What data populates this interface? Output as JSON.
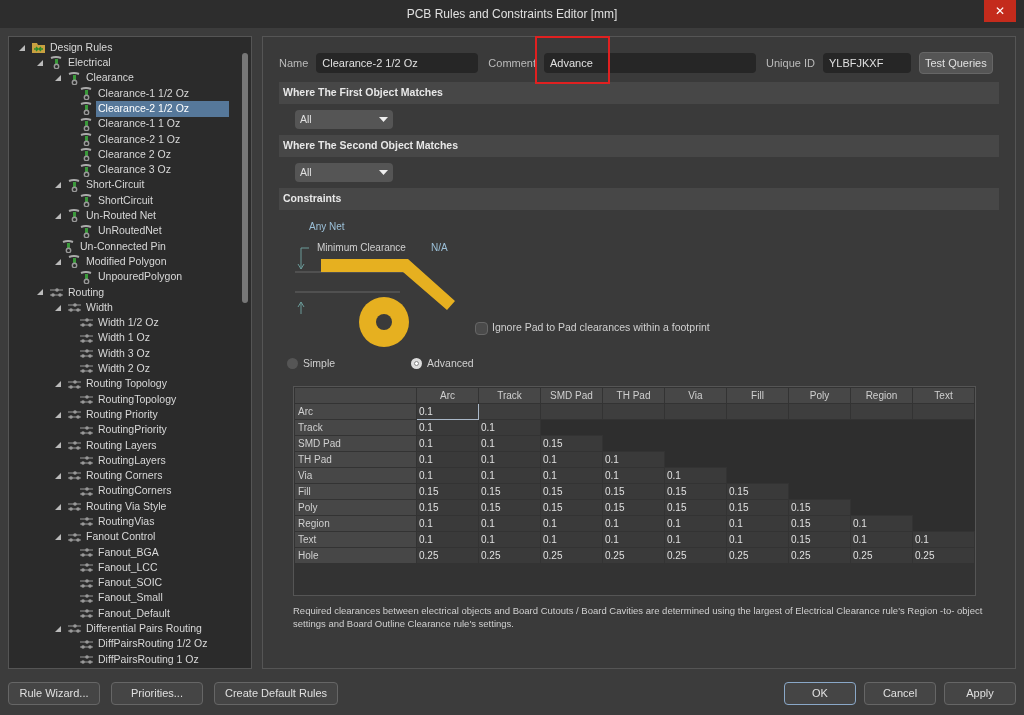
{
  "window": {
    "title": "PCB Rules and Constraints Editor [mm]",
    "close": "✕"
  },
  "tree": [
    {
      "label": "Design Rules",
      "kind": "root",
      "expanded": true,
      "selected": false,
      "children": [
        {
          "label": "Electrical",
          "kind": "electrical",
          "expanded": true,
          "selected": false,
          "children": [
            {
              "label": "Clearance",
              "kind": "electrical",
              "expanded": true,
              "selected": false,
              "children": [
                {
                  "label": "Clearance-1 1/2 Oz",
                  "kind": "electrical",
                  "selected": false
                },
                {
                  "label": "Clearance-2 1/2 Oz",
                  "kind": "electrical",
                  "selected": true
                },
                {
                  "label": "Clearance-1 1 Oz",
                  "kind": "electrical",
                  "selected": false
                },
                {
                  "label": "Clearance-2 1 Oz",
                  "kind": "electrical",
                  "selected": false
                },
                {
                  "label": "Clearance 2 Oz",
                  "kind": "electrical",
                  "selected": false
                },
                {
                  "label": "Clearance 3 Oz",
                  "kind": "electrical",
                  "selected": false
                }
              ]
            },
            {
              "label": "Short-Circuit",
              "kind": "electrical",
              "expanded": true,
              "selected": false,
              "children": [
                {
                  "label": "ShortCircuit",
                  "kind": "electrical",
                  "selected": false
                }
              ]
            },
            {
              "label": "Un-Routed Net",
              "kind": "electrical",
              "expanded": true,
              "selected": false,
              "children": [
                {
                  "label": "UnRoutedNet",
                  "kind": "electrical",
                  "selected": false
                }
              ]
            },
            {
              "label": "Un-Connected Pin",
              "kind": "electrical",
              "selected": false
            },
            {
              "label": "Modified Polygon",
              "kind": "electrical",
              "expanded": true,
              "selected": false,
              "children": [
                {
                  "label": "UnpouredPolygon",
                  "kind": "electrical",
                  "selected": false
                }
              ]
            }
          ]
        },
        {
          "label": "Routing",
          "kind": "routing",
          "expanded": true,
          "selected": false,
          "children": [
            {
              "label": "Width",
              "kind": "routing",
              "expanded": true,
              "selected": false,
              "children": [
                {
                  "label": "Width 1/2 Oz",
                  "kind": "routing",
                  "selected": false
                },
                {
                  "label": "Width 1 Oz",
                  "kind": "routing",
                  "selected": false
                },
                {
                  "label": "Width 3 Oz",
                  "kind": "routing",
                  "selected": false
                },
                {
                  "label": "Width 2 Oz",
                  "kind": "routing",
                  "selected": false
                }
              ]
            },
            {
              "label": "Routing Topology",
              "kind": "routing",
              "expanded": true,
              "selected": false,
              "children": [
                {
                  "label": "RoutingTopology",
                  "kind": "routing",
                  "selected": false
                }
              ]
            },
            {
              "label": "Routing Priority",
              "kind": "routing",
              "expanded": true,
              "selected": false,
              "children": [
                {
                  "label": "RoutingPriority",
                  "kind": "routing",
                  "selected": false
                }
              ]
            },
            {
              "label": "Routing Layers",
              "kind": "routing",
              "expanded": true,
              "selected": false,
              "children": [
                {
                  "label": "RoutingLayers",
                  "kind": "routing",
                  "selected": false
                }
              ]
            },
            {
              "label": "Routing Corners",
              "kind": "routing",
              "expanded": true,
              "selected": false,
              "children": [
                {
                  "label": "RoutingCorners",
                  "kind": "routing",
                  "selected": false
                }
              ]
            },
            {
              "label": "Routing Via Style",
              "kind": "routing",
              "expanded": true,
              "selected": false,
              "children": [
                {
                  "label": "RoutingVias",
                  "kind": "routing",
                  "selected": false
                }
              ]
            },
            {
              "label": "Fanout Control",
              "kind": "routing",
              "expanded": true,
              "selected": false,
              "children": [
                {
                  "label": "Fanout_BGA",
                  "kind": "routing",
                  "selected": false
                },
                {
                  "label": "Fanout_LCC",
                  "kind": "routing",
                  "selected": false
                },
                {
                  "label": "Fanout_SOIC",
                  "kind": "routing",
                  "selected": false
                },
                {
                  "label": "Fanout_Small",
                  "kind": "routing",
                  "selected": false
                },
                {
                  "label": "Fanout_Default",
                  "kind": "routing",
                  "selected": false
                }
              ]
            },
            {
              "label": "Differential Pairs Routing",
              "kind": "routing",
              "expanded": true,
              "selected": false,
              "children": [
                {
                  "label": "DiffPairsRouting 1/2 Oz",
                  "kind": "routing",
                  "selected": false
                },
                {
                  "label": "DiffPairsRouting 1 Oz",
                  "kind": "routing",
                  "selected": false
                }
              ]
            }
          ]
        }
      ]
    }
  ],
  "header": {
    "name_label": "Name",
    "name": "Clearance-2 1/2 Oz",
    "comment_label": "Comment",
    "comment": "Advance",
    "comment_highlighted": true,
    "id_label": "Unique ID",
    "id": "YLBFJKXF",
    "test_button": "Test Queries"
  },
  "sections": [
    {
      "title": "Where The First Object Matches",
      "dropdown": "All"
    },
    {
      "title": "Where The Second Object Matches",
      "dropdown": "All"
    },
    {
      "title": "Constraints"
    }
  ],
  "constraints": {
    "net_label": "Any Net",
    "min_clearance_label": "Minimum Clearance",
    "min_clearance_value": "N/A",
    "ignore_pad": {
      "label": "Ignore Pad to Pad clearances within a footprint",
      "checked": false
    },
    "modes": [
      {
        "label": "Simple",
        "selected": false
      },
      {
        "label": "Advanced",
        "selected": true
      }
    ]
  },
  "table": {
    "columns": [
      "Arc",
      "Track",
      "SMD Pad",
      "TH Pad",
      "Via",
      "Fill",
      "Poly",
      "Region",
      "Text"
    ],
    "rows": [
      {
        "label": "Arc",
        "cells": [
          {
            "value": "0.1",
            "selected": true
          }
        ]
      },
      {
        "label": "Track",
        "cells": [
          {
            "value": "0.1",
            "selected": false
          },
          {
            "value": "0.1",
            "selected": false
          }
        ]
      },
      {
        "label": "SMD Pad",
        "cells": [
          {
            "value": "0.1",
            "selected": false
          },
          {
            "value": "0.1",
            "selected": false
          },
          {
            "value": "0.15",
            "selected": false
          }
        ]
      },
      {
        "label": "TH Pad",
        "cells": [
          {
            "value": "0.1",
            "selected": false
          },
          {
            "value": "0.1",
            "selected": false
          },
          {
            "value": "0.1",
            "selected": false
          },
          {
            "value": "0.1",
            "selected": false
          }
        ]
      },
      {
        "label": "Via",
        "cells": [
          {
            "value": "0.1",
            "selected": false
          },
          {
            "value": "0.1",
            "selected": false
          },
          {
            "value": "0.1",
            "selected": false
          },
          {
            "value": "0.1",
            "selected": false
          },
          {
            "value": "0.1",
            "selected": false
          }
        ]
      },
      {
        "label": "Fill",
        "cells": [
          {
            "value": "0.15",
            "selected": false
          },
          {
            "value": "0.15",
            "selected": false
          },
          {
            "value": "0.15",
            "selected": false
          },
          {
            "value": "0.15",
            "selected": false
          },
          {
            "value": "0.15",
            "selected": false
          },
          {
            "value": "0.15",
            "selected": false
          }
        ]
      },
      {
        "label": "Poly",
        "cells": [
          {
            "value": "0.15",
            "selected": false
          },
          {
            "value": "0.15",
            "selected": false
          },
          {
            "value": "0.15",
            "selected": false
          },
          {
            "value": "0.15",
            "selected": false
          },
          {
            "value": "0.15",
            "selected": false
          },
          {
            "value": "0.15",
            "selected": false
          },
          {
            "value": "0.15",
            "selected": false
          }
        ]
      },
      {
        "label": "Region",
        "cells": [
          {
            "value": "0.1",
            "selected": false
          },
          {
            "value": "0.1",
            "selected": false
          },
          {
            "value": "0.1",
            "selected": false
          },
          {
            "value": "0.1",
            "selected": false
          },
          {
            "value": "0.1",
            "selected": false
          },
          {
            "value": "0.1",
            "selected": false
          },
          {
            "value": "0.15",
            "selected": false
          },
          {
            "value": "0.1",
            "selected": false
          }
        ]
      },
      {
        "label": "Text",
        "cells": [
          {
            "value": "0.1",
            "selected": false
          },
          {
            "value": "0.1",
            "selected": false
          },
          {
            "value": "0.1",
            "selected": false
          },
          {
            "value": "0.1",
            "selected": false
          },
          {
            "value": "0.1",
            "selected": false
          },
          {
            "value": "0.1",
            "selected": false
          },
          {
            "value": "0.15",
            "selected": false
          },
          {
            "value": "0.1",
            "selected": false
          },
          {
            "value": "0.1",
            "selected": false
          }
        ]
      },
      {
        "label": "Hole",
        "cells": [
          {
            "value": "0.25",
            "selected": false
          },
          {
            "value": "0.25",
            "selected": false
          },
          {
            "value": "0.25",
            "selected": false
          },
          {
            "value": "0.25",
            "selected": false
          },
          {
            "value": "0.25",
            "selected": false
          },
          {
            "value": "0.25",
            "selected": false
          },
          {
            "value": "0.25",
            "selected": false
          },
          {
            "value": "0.25",
            "selected": false
          },
          {
            "value": "0.25",
            "selected": false
          }
        ]
      }
    ]
  },
  "note": "Required clearances between electrical objects and Board Cutouts / Board Cavities are determined using the largest of Electrical Clearance rule's Region -to- object settings and Board Outline Clearance rule's settings.",
  "footer": {
    "left_buttons": [
      "Rule Wizard...",
      "Priorities...",
      "Create Default Rules"
    ],
    "right_buttons": [
      {
        "label": "OK",
        "default": true
      },
      {
        "label": "Cancel",
        "default": false
      },
      {
        "label": "Apply",
        "default": false
      }
    ]
  }
}
